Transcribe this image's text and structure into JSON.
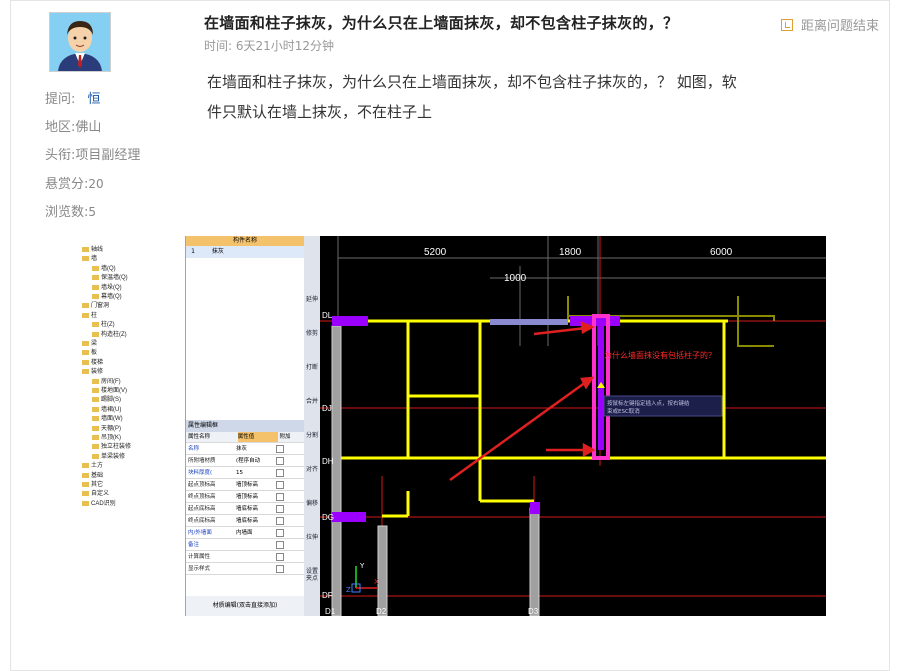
{
  "question": {
    "title": "在墙面和柱子抹灰，为什么只在上墙面抹灰，却不包含柱子抹灰的，？",
    "time_label": "时间:",
    "time_value": "6天21小时12分钟",
    "status": "距离问题结束",
    "body_line1": "在墙面和柱子抹灰，为什么只在上墙面抹灰，却不包含柱子抹灰的，？  如图，软",
    "body_line2": "件只默认在墙上抹灰，不在柱子上"
  },
  "asker": {
    "ask_label": "提问:",
    "ask_value": "恒",
    "region_label": "地区:",
    "region_value": "佛山",
    "title_label": "头衔:",
    "title_value": "项目副经理",
    "bounty_label": "悬赏分:",
    "bounty_value": "20",
    "views_label": "浏览数:",
    "views_value": "5"
  },
  "screenshot": {
    "tree_items": [
      "轴线",
      "墙",
      "墙(Q)",
      "保温墙(Q)",
      "墙垛(Q)",
      "幕墙(Q)",
      "门窗洞",
      "柱",
      "柱(Z)",
      "构造柱(Z)",
      "梁",
      "板",
      "楼梯",
      "装修",
      "房间(F)",
      "楼地面(V)",
      "踢脚(S)",
      "墙裙(U)",
      "墙面(W)",
      "天棚(P)",
      "吊顶(K)",
      "独立柱装修",
      "单梁装修",
      "土方",
      "基础",
      "其它",
      "自定义",
      "CAD识别"
    ],
    "list_header": "构件名称",
    "list_row_num": "1",
    "list_row_name": "抹灰",
    "prop_title": "属性编辑框",
    "prop_cols": [
      "属性名称",
      "属性值",
      "附加"
    ],
    "prop_rows": [
      {
        "name": "名称",
        "value": "抹灰"
      },
      {
        "name": "所附墙材质",
        "value": "(程序自动"
      },
      {
        "name": "块料厚度(",
        "value": "15"
      },
      {
        "name": "起点顶标高",
        "value": "墙顶标高"
      },
      {
        "name": "终点顶标高",
        "value": "墙顶标高"
      },
      {
        "name": "起点底标高",
        "value": "墙底标高"
      },
      {
        "name": "终点底标高",
        "value": "墙底标高"
      },
      {
        "name": "内/外墙面",
        "value": "内墙面"
      },
      {
        "name": "备注",
        "value": ""
      },
      {
        "name": "计算属性",
        "value": ""
      },
      {
        "name": "显示样式",
        "value": ""
      }
    ],
    "prop_footer": "材质编辑(双击直接添加)",
    "tool_labels": [
      "延伸",
      "修剪",
      "打断",
      "合并",
      "分割",
      "对齐",
      "偏移",
      "拉伸",
      "设置夹点"
    ],
    "dim_top": [
      "5200",
      "1800",
      "6000"
    ],
    "dim_second": "1000",
    "axis_labels": [
      "DL",
      "DJ",
      "DH",
      "DG",
      "DF",
      "D1",
      "D2",
      "D3"
    ],
    "annotation": "为什么墙面抹没有包括柱子的？",
    "tooltip_line1": "按鼠标左键指定插入点，按右键结",
    "tooltip_line2": "束或ESC取消",
    "ucs_y": "Y",
    "ucs_x": "X",
    "ucs_z": "Z",
    "colors": {
      "wall": "#ffff00",
      "purple": "#9b00ff",
      "magenta": "#ff33cc",
      "red_line": "#ff2020",
      "olive": "#8a8a00"
    }
  }
}
